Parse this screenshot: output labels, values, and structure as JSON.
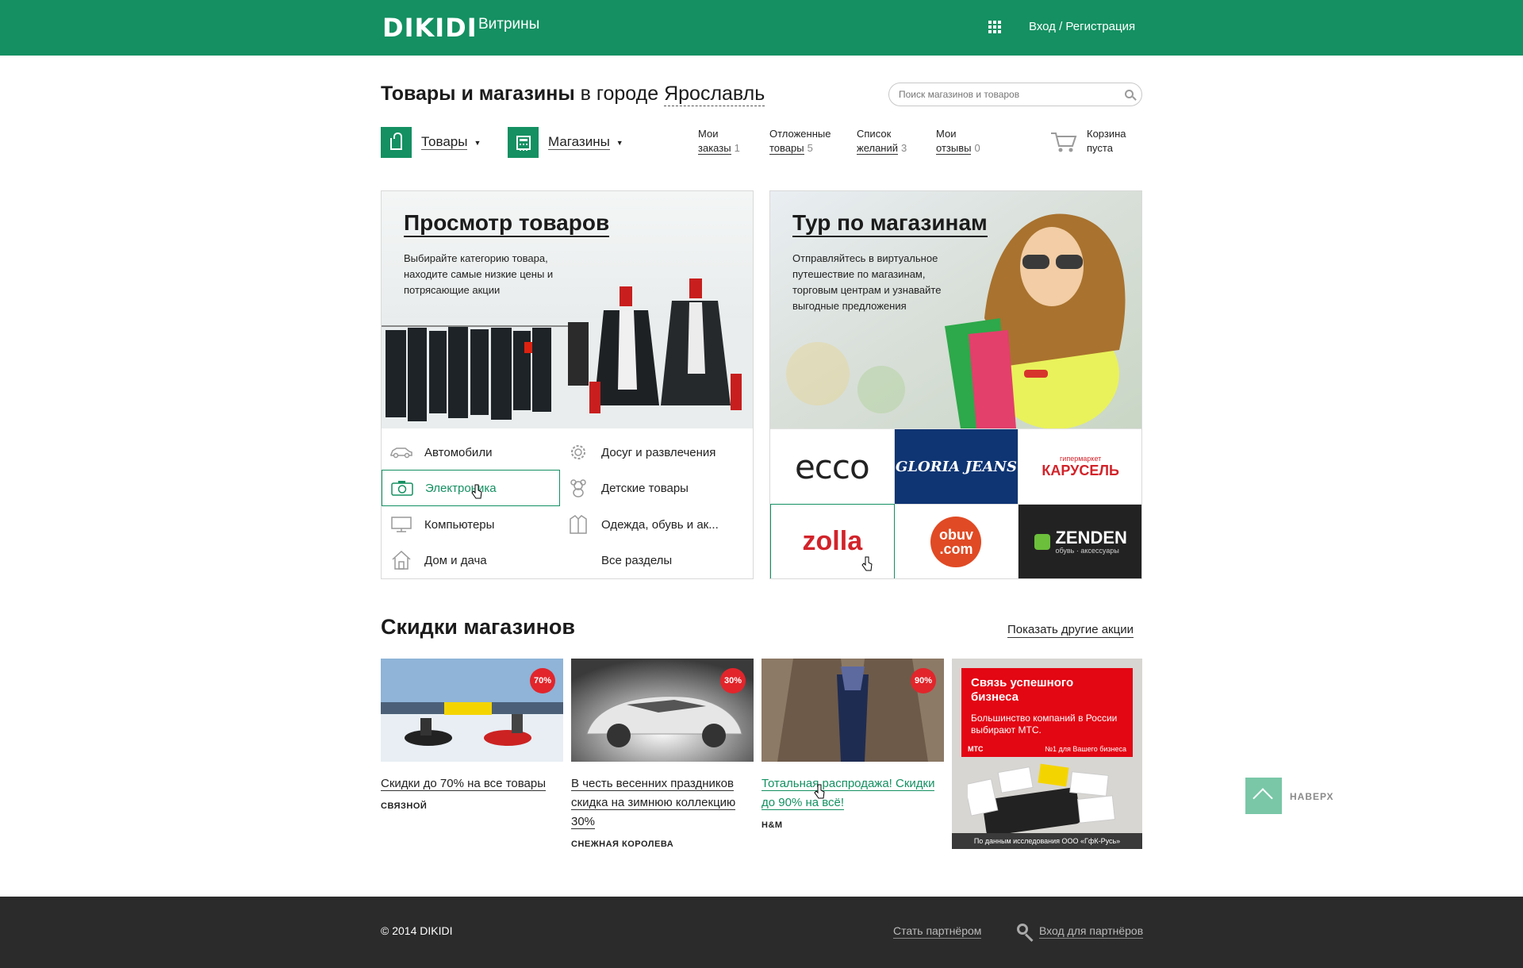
{
  "header": {
    "logo": "DIKIDI",
    "logo_sub": "Витрины",
    "login": "Вход / Регистрация"
  },
  "title": {
    "bold": "Товары и магазины",
    "mid": " в городе ",
    "city": "Ярославль"
  },
  "search": {
    "placeholder": "Поиск магазинов и товаров"
  },
  "nav": {
    "goods": "Товары",
    "shops": "Магазины"
  },
  "user_links": [
    {
      "line1": "Мои",
      "line2": "заказы",
      "count": "1"
    },
    {
      "line1": "Отложенные",
      "line2": "товары",
      "count": "5"
    },
    {
      "line1": "Список",
      "line2": "желаний",
      "count": "3"
    },
    {
      "line1": "Мои",
      "line2": "отзывы",
      "count": "0"
    }
  ],
  "cart": {
    "line1": "Корзина",
    "line2": "пуста"
  },
  "goods_card": {
    "title": "Просмотр товаров",
    "desc": "Выбирайте категорию товара, находите самые низкие цены и потрясающие акции",
    "categories": [
      {
        "label": "Автомобили",
        "icon": "car-icon"
      },
      {
        "label": "Досуг и развлечения",
        "icon": "gear-icon"
      },
      {
        "label": "Электроника",
        "icon": "camera-icon"
      },
      {
        "label": "Детские товары",
        "icon": "teddy-bear-icon"
      },
      {
        "label": "Компьютеры",
        "icon": "monitor-icon"
      },
      {
        "label": "Одежда, обувь и ак...",
        "icon": "coat-icon"
      },
      {
        "label": "Дом и дача",
        "icon": "house-icon"
      },
      {
        "label": "Все разделы",
        "icon": ""
      }
    ]
  },
  "shops_card": {
    "title": "Тур по магазинам",
    "desc": "Отправляйтесь в виртуальное путешествие по магазинам, торговым центрам и узнавайте выгодные предложения",
    "stores": [
      {
        "name": "ecco"
      },
      {
        "name": "GLORIA JEANS"
      },
      {
        "name": "КАРУСЕЛЬ",
        "sub": "гипермаркет"
      },
      {
        "name": "zolla"
      },
      {
        "name": "obuv",
        "sub": ".com"
      },
      {
        "name": "ZENDEN",
        "sub": "обувь · аксессуары"
      }
    ]
  },
  "discounts": {
    "title": "Скидки магазинов",
    "more": "Показать другие акции",
    "items": [
      {
        "text": "Скидки до 70% на все товары",
        "store": "Связной",
        "badge": "70%"
      },
      {
        "text": "В честь весенних праздников скидка на зимнюю коллекцию 30%",
        "store": "Снежная королева",
        "badge": "30%"
      },
      {
        "text": "Тотальная распродажа! Скидки до 90% на всё!",
        "store": "H&M",
        "badge": "90%"
      }
    ]
  },
  "ad": {
    "title": "Связь успешного бизнеса",
    "subtitle": "Большинство компаний в России выбирают МТС.",
    "brand": "МТС",
    "tag": "№1 для Вашего бизнеса",
    "footer": "По данным исследования ООО «ГфК-Русь»"
  },
  "to_top": "НАВЕРХ",
  "footer": {
    "copy": "© 2014 DIKIDI",
    "partner": "Стать партнёром",
    "partner_login": "Вход для партнёров"
  }
}
